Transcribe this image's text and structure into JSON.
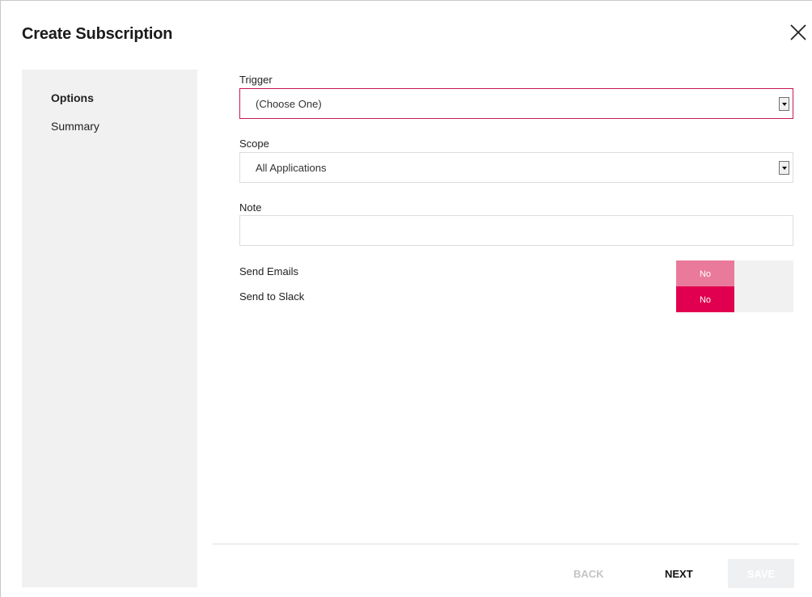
{
  "dialog": {
    "title": "Create Subscription"
  },
  "icons": {
    "close": "close-icon",
    "dropdown": "chevron-down-icon"
  },
  "sidebar": {
    "items": [
      {
        "label": "Options",
        "active": true
      },
      {
        "label": "Summary",
        "active": false
      }
    ]
  },
  "form": {
    "trigger": {
      "label": "Trigger",
      "value": "(Choose One)"
    },
    "scope": {
      "label": "Scope",
      "value": "All Applications"
    },
    "note": {
      "label": "Note",
      "value": "",
      "placeholder": ""
    },
    "send_emails": {
      "label": "Send Emails",
      "value": "No"
    },
    "send_slack": {
      "label": "Send to Slack",
      "value": "No"
    }
  },
  "footer": {
    "back_label": "BACK",
    "next_label": "NEXT",
    "save_label": "SAVE"
  },
  "colors": {
    "accent": "#e0004f",
    "accent_light": "#ea7a9c",
    "invalid_border": "#c8194e",
    "panel_bg": "#f1f1f2"
  }
}
